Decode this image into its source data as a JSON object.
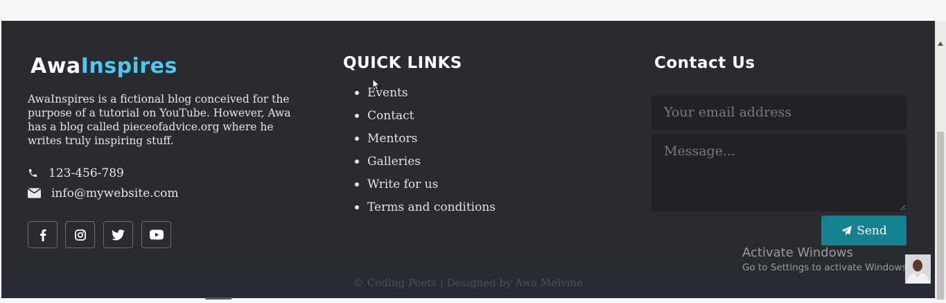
{
  "brand": {
    "part1": "Awa",
    "part2": "Inspires"
  },
  "about": "AwaInspires is a fictional blog conceived for the purpose of a tutorial on YouTube. However, Awa has a blog called pieceofadvice.org where he writes truly inspiring stuff.",
  "contact_info": {
    "phone": "123-456-789",
    "email": "info@mywebsite.com"
  },
  "social": [
    "facebook-icon",
    "instagram-icon",
    "twitter-icon",
    "youtube-icon"
  ],
  "quick_links": {
    "heading": "QUICK LINKS",
    "items": [
      "Events",
      "Contact",
      "Mentors",
      "Galleries",
      "Write for us",
      "Terms and conditions"
    ]
  },
  "contact_form": {
    "heading": "Contact Us",
    "email_placeholder": "Your email address",
    "message_placeholder": "Message...",
    "send_label": "Send"
  },
  "copyright": "© Coding Poets | Designed by Awa Melvine",
  "watermark": {
    "line1": "Activate Windows",
    "line2": "Go to Settings to activate Windows."
  },
  "colors": {
    "footer_bg": "#2a2a31",
    "brand_accent": "#4cc9f0",
    "button": "#15808f"
  }
}
